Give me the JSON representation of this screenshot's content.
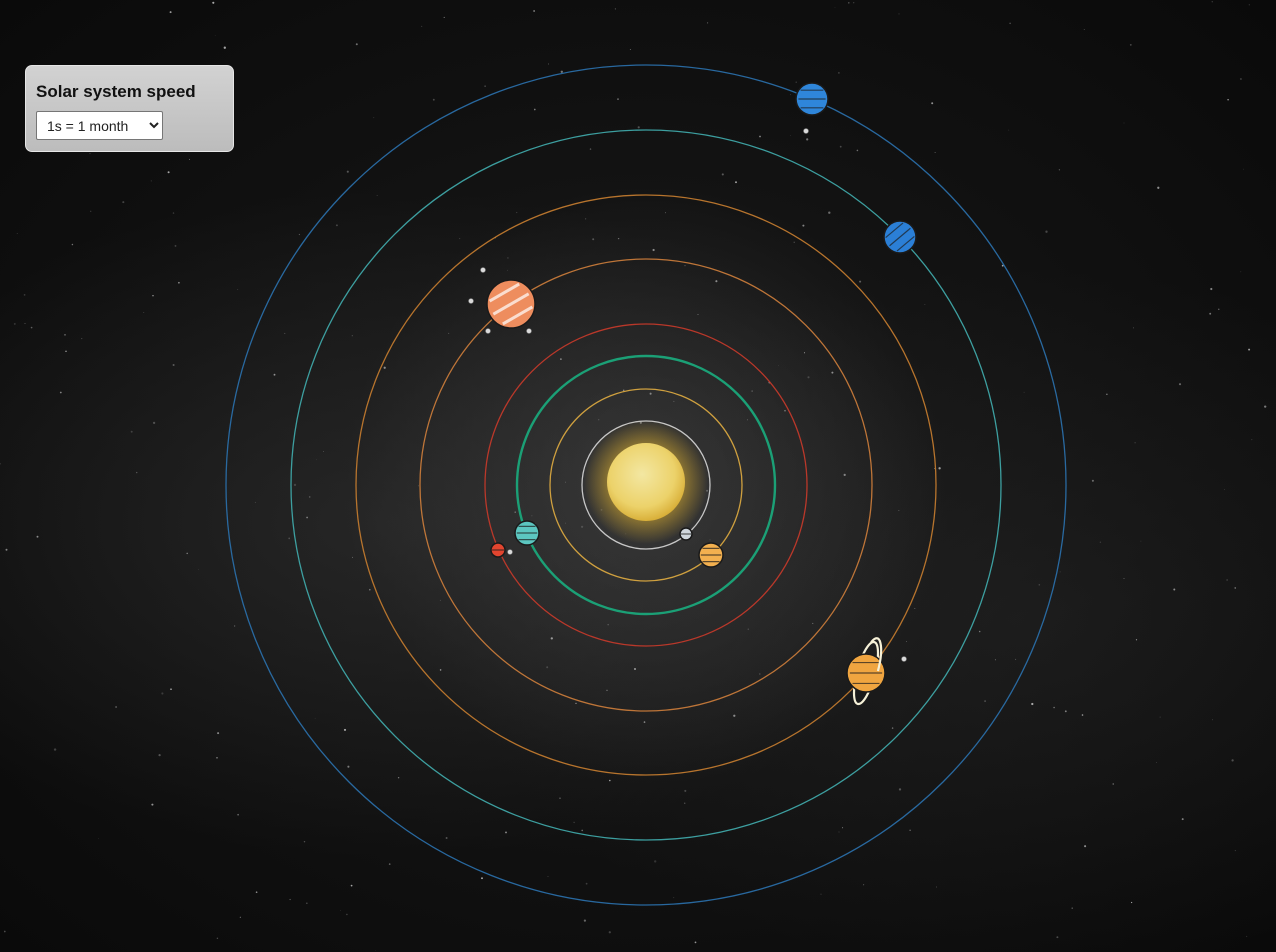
{
  "panel": {
    "title": "Solar system speed",
    "speed_select": {
      "selected": "1s = 1 month",
      "options": [
        "1s = 1 month"
      ]
    }
  },
  "scene": {
    "background_color": "#0b0b0b",
    "sun": {
      "name": "sun",
      "color": "#f2dc78",
      "glow": "#f5c842"
    },
    "orbits": [
      {
        "body": "mercury",
        "color": "#d0d0d0",
        "strong": false
      },
      {
        "body": "venus",
        "color": "#d8a640",
        "strong": false
      },
      {
        "body": "earth",
        "color": "#1aa77a",
        "strong": true
      },
      {
        "body": "mars",
        "color": "#c2392a",
        "strong": false
      },
      {
        "body": "jupiter",
        "color": "#c77a3a",
        "strong": false
      },
      {
        "body": "saturn",
        "color": "#c0792e",
        "strong": false
      },
      {
        "body": "uranus",
        "color": "#3fa7a8",
        "strong": false
      },
      {
        "body": "neptune",
        "color": "#2a6ea8",
        "strong": false
      }
    ],
    "planets": [
      {
        "name": "mercury",
        "color": "#cfd6dc",
        "icon": "mercury-icon"
      },
      {
        "name": "venus",
        "color": "#f3b04f",
        "icon": "venus-icon"
      },
      {
        "name": "earth",
        "color": "#5cc6c0",
        "icon": "earth-icon"
      },
      {
        "name": "mars",
        "color": "#e2452f",
        "icon": "mars-icon"
      },
      {
        "name": "jupiter",
        "color": "#ee8d5e",
        "icon": "jupiter-icon"
      },
      {
        "name": "saturn",
        "color": "#f0a540",
        "icon": "saturn-icon"
      },
      {
        "name": "uranus",
        "color": "#2b7fd6",
        "icon": "uranus-icon"
      },
      {
        "name": "neptune",
        "color": "#2f86da",
        "icon": "neptune-icon"
      }
    ]
  }
}
